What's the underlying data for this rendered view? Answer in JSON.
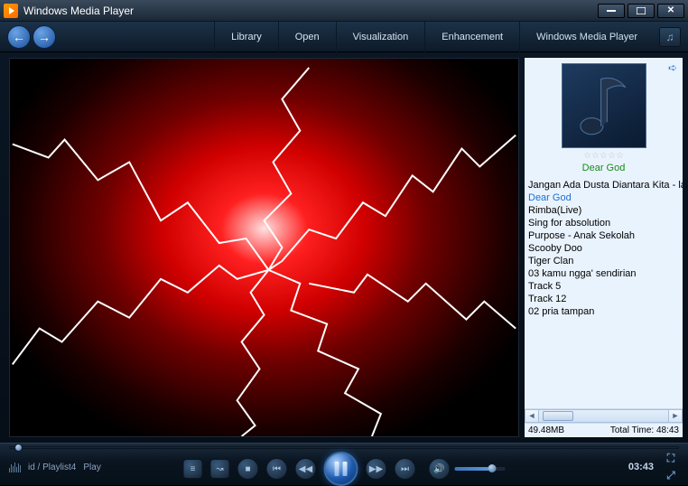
{
  "window": {
    "title": "Windows Media Player"
  },
  "toolbar": {
    "library": "Library",
    "open": "Open",
    "visualization": "Visualization",
    "enhancement": "Enhancement",
    "appname": "Windows Media Player"
  },
  "nowplaying": {
    "title": "Dear God",
    "rating_glyphs": "☆☆☆☆☆"
  },
  "playlist": {
    "items": [
      "Jangan Ada Dusta Diantara Kita - la",
      "Dear God",
      "Rimba(Live)",
      "Sing for absolution",
      "Purpose - Anak Sekolah",
      "Scooby Doo",
      "Tiger Clan",
      "03 kamu ngga' sendirian",
      "Track 5",
      "Track 12",
      "02 pria tampan"
    ],
    "current_index": 1
  },
  "status": {
    "size": "49.48MB",
    "total_time_label": "Total Time: 48:43"
  },
  "controls": {
    "playlist_label": "id / Playlist4",
    "extra_label": "Play",
    "elapsed": "03:43"
  }
}
